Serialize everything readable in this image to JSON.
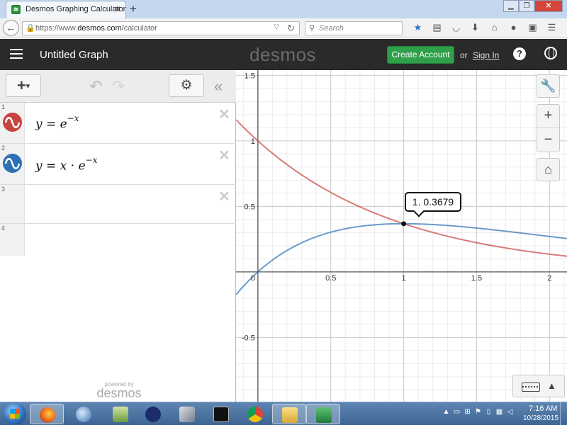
{
  "browser": {
    "tab_title": "Desmos Graphing Calculator",
    "tab_favicon": "desmos-favicon",
    "url_prefix": "https://www.",
    "url_domain": "desmos.com",
    "url_path": "/calculator",
    "search_placeholder": "Search",
    "toolbar_icons": [
      "star-icon",
      "reading-list-icon",
      "pocket-icon",
      "download-icon",
      "home-icon",
      "chat-icon",
      "extension-icon",
      "menu-icon"
    ]
  },
  "desmos": {
    "graph_title": "Untitled Graph",
    "logo_text": "desmos",
    "create_account_label": "Create Account",
    "or_text": "or",
    "sign_in_label": "Sign In",
    "help_label": "?"
  },
  "expressions": [
    {
      "num": "1",
      "color": "#c74440",
      "lhs": "y",
      "op": " = ",
      "base": "e",
      "exp": "−x",
      "mid": ""
    },
    {
      "num": "2",
      "color": "#2d70b3",
      "lhs": "y",
      "op": " = ",
      "base": "e",
      "exp": "−x",
      "mid": "x · "
    },
    {
      "num": "3"
    },
    {
      "num": "4"
    }
  ],
  "powered_by": {
    "small": "powered by",
    "logo": "desmos"
  },
  "graph": {
    "x_range": [
      -0.15,
      2.12
    ],
    "y_range": [
      -0.99,
      1.54
    ],
    "x_tick_labels": [
      "0.5",
      "1",
      "1.5",
      "2"
    ],
    "x_tick_values": [
      0.5,
      1,
      1.5,
      2
    ],
    "y_tick_labels": [
      "1.5",
      "1",
      "0.5",
      "-0.5"
    ],
    "y_tick_values": [
      1.5,
      1,
      0.5,
      -0.5
    ],
    "origin_label": "0",
    "curve_colors": [
      "#c74440",
      "#2d70b3"
    ],
    "point": {
      "x": 1,
      "y": 0.3679
    },
    "point_label": "1, 0.3679",
    "zoom_in_label": "+",
    "zoom_out_label": "−"
  },
  "taskbar": {
    "apps": [
      "firefox",
      "thunderbird",
      "network",
      "app-d",
      "tools",
      "cmd",
      "chrome",
      "folder",
      "excel"
    ],
    "time": "7:16 AM",
    "date": "10/28/2015"
  }
}
